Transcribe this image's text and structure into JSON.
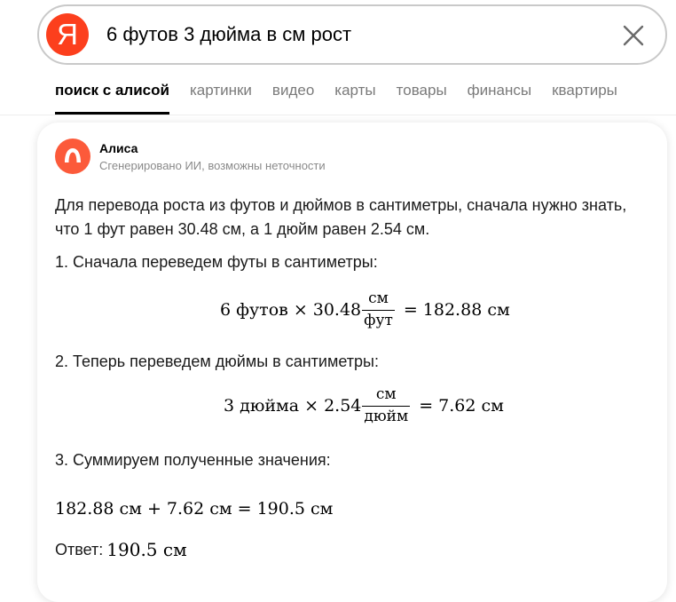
{
  "search": {
    "logo_letter": "Я",
    "query": "6 футов 3 дюйма в см рост"
  },
  "tabs": [
    {
      "label": "поиск с алисой",
      "active": true
    },
    {
      "label": "картинки",
      "active": false
    },
    {
      "label": "видео",
      "active": false
    },
    {
      "label": "карты",
      "active": false
    },
    {
      "label": "товары",
      "active": false
    },
    {
      "label": "финансы",
      "active": false
    },
    {
      "label": "квартиры",
      "active": false
    }
  ],
  "answer": {
    "author": "Алиса",
    "disclaimer": "Сгенерировано ИИ, возможны неточности",
    "intro": "Для перевода роста из футов и дюймов в сантиметры, сначала нужно знать, что 1 фут равен 30.48 см, а 1 дюйм равен 2.54 см.",
    "step1": "1.  Сначала переведем футы в сантиметры:",
    "formula1": {
      "left": "6 футов",
      "times": "×",
      "coef": "30.48",
      "num": "см",
      "den": "фут",
      "eq": "=",
      "result": "182.88 см"
    },
    "step2": "2.  Теперь переведем дюймы в сантиметры:",
    "formula2": {
      "left": "3 дюйма",
      "times": "×",
      "coef": "2.54",
      "num": "см",
      "den": "дюйм",
      "eq": "=",
      "result": "7.62 см"
    },
    "step3": "3.  Суммируем полученные значения:",
    "sum": {
      "a": "182.88 см",
      "plus": "+",
      "b": "7.62 см",
      "eq": "=",
      "result": "190.5 см"
    },
    "answer_label": "Ответ:",
    "answer_value": "190.5 см"
  },
  "colors": {
    "brand": "#fc3f1d",
    "alice_avatar": "#fc5a3a",
    "tab_inactive": "#7a7a7a",
    "muted_text": "#8a8a8a"
  },
  "icons": {
    "clear": "close-icon",
    "alice": "alice-icon"
  }
}
